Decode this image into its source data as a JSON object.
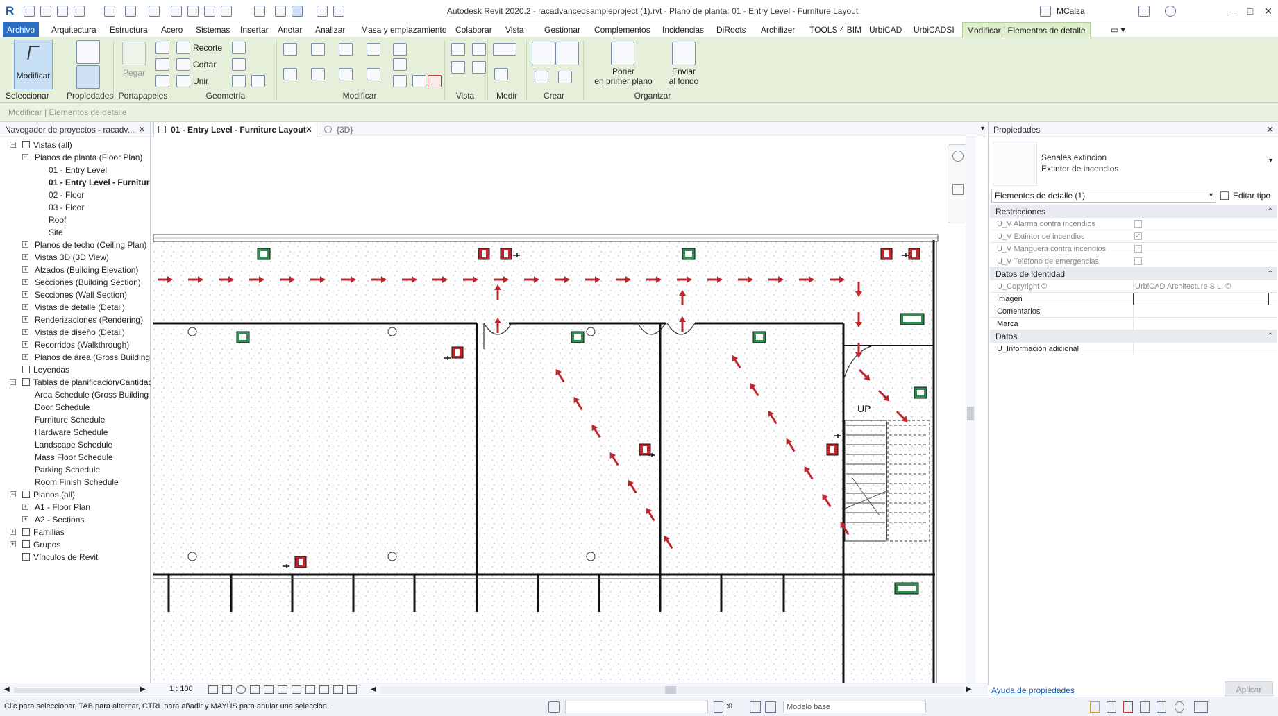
{
  "app": {
    "title": "Autodesk Revit 2020.2 - racadvancedsampleproject (1).rvt - Plano de planta: 01 - Entry Level - Furniture Layout",
    "user": "MCalza",
    "logo": "R"
  },
  "menu": {
    "items": [
      "Archivo",
      "Arquitectura",
      "Estructura",
      "Acero",
      "Sistemas",
      "Insertar",
      "Anotar",
      "Analizar",
      "Masa y emplazamiento",
      "Colaborar",
      "Vista",
      "Gestionar",
      "Complementos",
      "Incidencias",
      "DiRoots",
      "Archilizer",
      "TOOLS 4 BIM",
      "UrbiCAD",
      "UrbiCADSI",
      "Modificar | Elementos de detalle"
    ]
  },
  "ribbon": {
    "modify": "Modificar",
    "paste": "Pegar",
    "recorte": "Recorte",
    "cortar": "Cortar",
    "unir": "Unir",
    "bring_front_1": "Poner",
    "bring_front_2": "en primer plano",
    "send_back_1": "Enviar",
    "send_back_2": "al fondo",
    "panels": {
      "select": "Seleccionar",
      "props": "Propiedades",
      "clip": "Portapapeles",
      "geom": "Geometría",
      "mod": "Modificar",
      "view": "Vista",
      "measure": "Medir",
      "create": "Crear",
      "arrange": "Organizar"
    }
  },
  "optionsbar": "Modificar | Elementos de detalle",
  "browser": {
    "title": "Navegador de proyectos - racadv...",
    "items": [
      {
        "label": "Vistas (all)",
        "level": 0,
        "tog": "−",
        "icon": true
      },
      {
        "label": "Planos de planta (Floor Plan)",
        "level": 1,
        "tog": "−"
      },
      {
        "label": "01 - Entry Level",
        "level": 2
      },
      {
        "label": "01 - Entry Level - Furnitur",
        "level": 2,
        "bold": true
      },
      {
        "label": "02 - Floor",
        "level": 2
      },
      {
        "label": "03 - Floor",
        "level": 2
      },
      {
        "label": "Roof",
        "level": 2
      },
      {
        "label": "Site",
        "level": 2
      },
      {
        "label": "Planos de techo (Ceiling Plan)",
        "level": 1,
        "tog": "+"
      },
      {
        "label": "Vistas 3D (3D View)",
        "level": 1,
        "tog": "+"
      },
      {
        "label": "Alzados (Building Elevation)",
        "level": 1,
        "tog": "+"
      },
      {
        "label": "Secciones (Building Section)",
        "level": 1,
        "tog": "+"
      },
      {
        "label": "Secciones (Wall Section)",
        "level": 1,
        "tog": "+"
      },
      {
        "label": "Vistas de detalle (Detail)",
        "level": 1,
        "tog": "+"
      },
      {
        "label": "Renderizaciones (Rendering)",
        "level": 1,
        "tog": "+"
      },
      {
        "label": "Vistas de diseño (Detail)",
        "level": 1,
        "tog": "+"
      },
      {
        "label": "Recorridos (Walkthrough)",
        "level": 1,
        "tog": "+"
      },
      {
        "label": "Planos de área (Gross Building",
        "level": 1,
        "tog": "+"
      },
      {
        "label": "Leyendas",
        "level": 0,
        "icon": true
      },
      {
        "label": "Tablas de planificación/Cantidad",
        "level": 0,
        "tog": "−",
        "icon": true
      },
      {
        "label": "Area Schedule (Gross Building",
        "level": 1
      },
      {
        "label": "Door Schedule",
        "level": 1
      },
      {
        "label": "Furniture Schedule",
        "level": 1
      },
      {
        "label": "Hardware Schedule",
        "level": 1
      },
      {
        "label": "Landscape Schedule",
        "level": 1
      },
      {
        "label": "Mass Floor Schedule",
        "level": 1
      },
      {
        "label": "Parking Schedule",
        "level": 1
      },
      {
        "label": "Room Finish Schedule",
        "level": 1
      },
      {
        "label": "Planos (all)",
        "level": 0,
        "tog": "−",
        "icon": true
      },
      {
        "label": "A1 - Floor Plan",
        "level": 1,
        "tog": "+"
      },
      {
        "label": "A2 - Sections",
        "level": 1,
        "tog": "+"
      },
      {
        "label": "Familias",
        "level": 0,
        "tog": "+",
        "icon": true
      },
      {
        "label": "Grupos",
        "level": 0,
        "tog": "+",
        "icon": true
      },
      {
        "label": "Vínculos de Revit",
        "level": 0,
        "icon": true
      }
    ]
  },
  "tabs": {
    "active": "01 - Entry Level - Furniture Layout",
    "other": "{3D}"
  },
  "canvas": {
    "up_label": "UP",
    "scale": "1 : 100"
  },
  "properties": {
    "title": "Propiedades",
    "type_line1": "Senales extincion",
    "type_line2": "Extintor de incendios",
    "selector": "Elementos de detalle (1)",
    "edit_type": "Editar tipo",
    "groups": {
      "restricciones": "Restricciones",
      "identidad": "Datos de identidad",
      "datos": "Datos"
    },
    "rows": {
      "alarma": "U_V Alarma contra incendios",
      "extintor": "U_V Extintor de incendios",
      "manguera": "U_V Manguera contra incendios",
      "telefono": "U_V Teléfono de emergencias",
      "copyright": "U_Copyright ©",
      "copyright_val": "UrbiCAD Architecture S.L. ©",
      "imagen": "Imagen",
      "comentarios": "Comentarios",
      "marca": "Marca",
      "info": "U_Información adicional"
    },
    "help": "Ayuda de propiedades",
    "apply": "Aplicar"
  },
  "status": {
    "hint": "Clic para seleccionar, TAB para alternar, CTRL para añadir y MAYÚS para anular una selección.",
    "zero": ":0",
    "model": "Modelo base"
  },
  "colors": {
    "accent": "#2b6dc2",
    "ribbon": "#e6efd9",
    "fire_red": "#c0272d",
    "exit_green": "#2f8a4f"
  }
}
